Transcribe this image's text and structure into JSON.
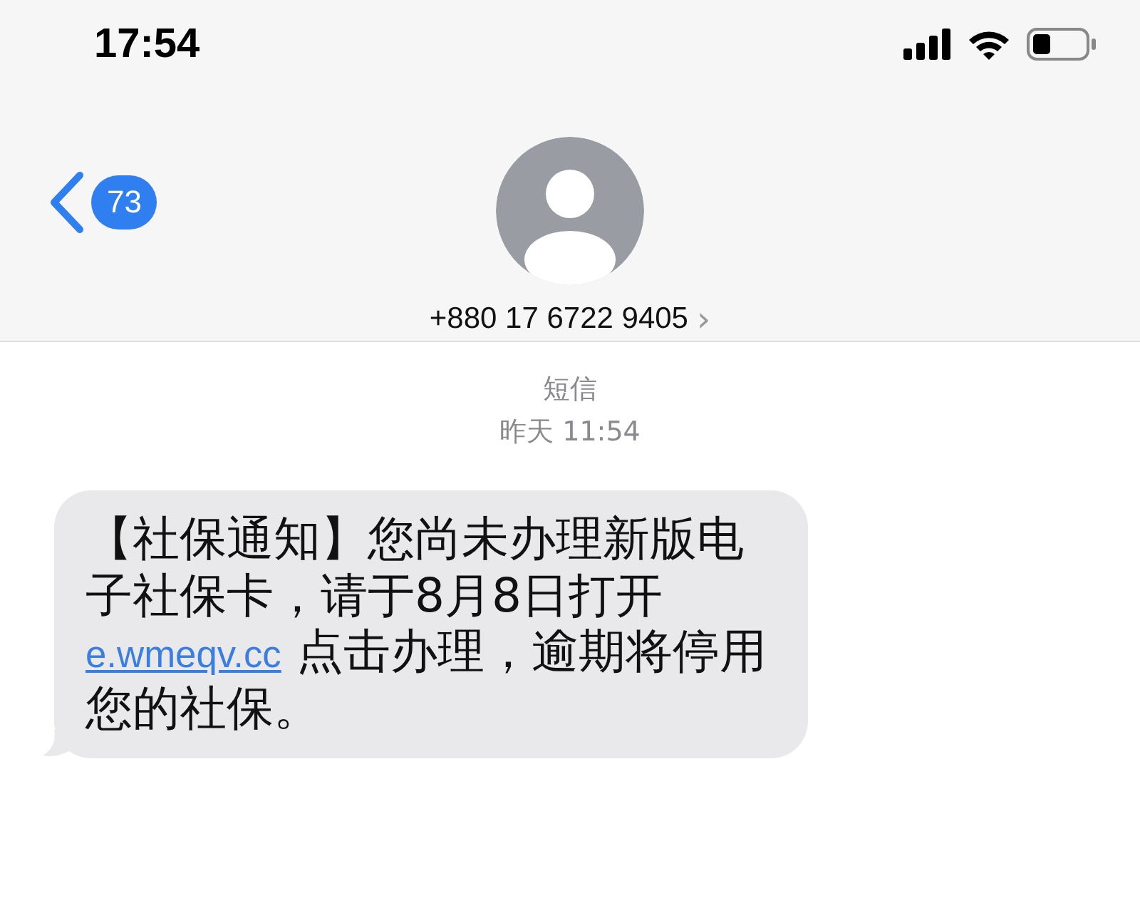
{
  "status_bar": {
    "time": "17:54"
  },
  "header": {
    "back_badge": "73",
    "contact": "+880 17 6722 9405",
    "chevron": "›"
  },
  "thread": {
    "service": "短信",
    "timestamp": "昨天 11:54"
  },
  "message": {
    "parts": [
      {
        "kind": "text",
        "text": "【社保通知】您尚未办理新版电子社保卡，请于8月8日打开"
      },
      {
        "kind": "link",
        "text": "e.wmeqv.cc"
      },
      {
        "kind": "text",
        "text": " 点击办理，逾期将停用您的社保。"
      }
    ]
  }
}
